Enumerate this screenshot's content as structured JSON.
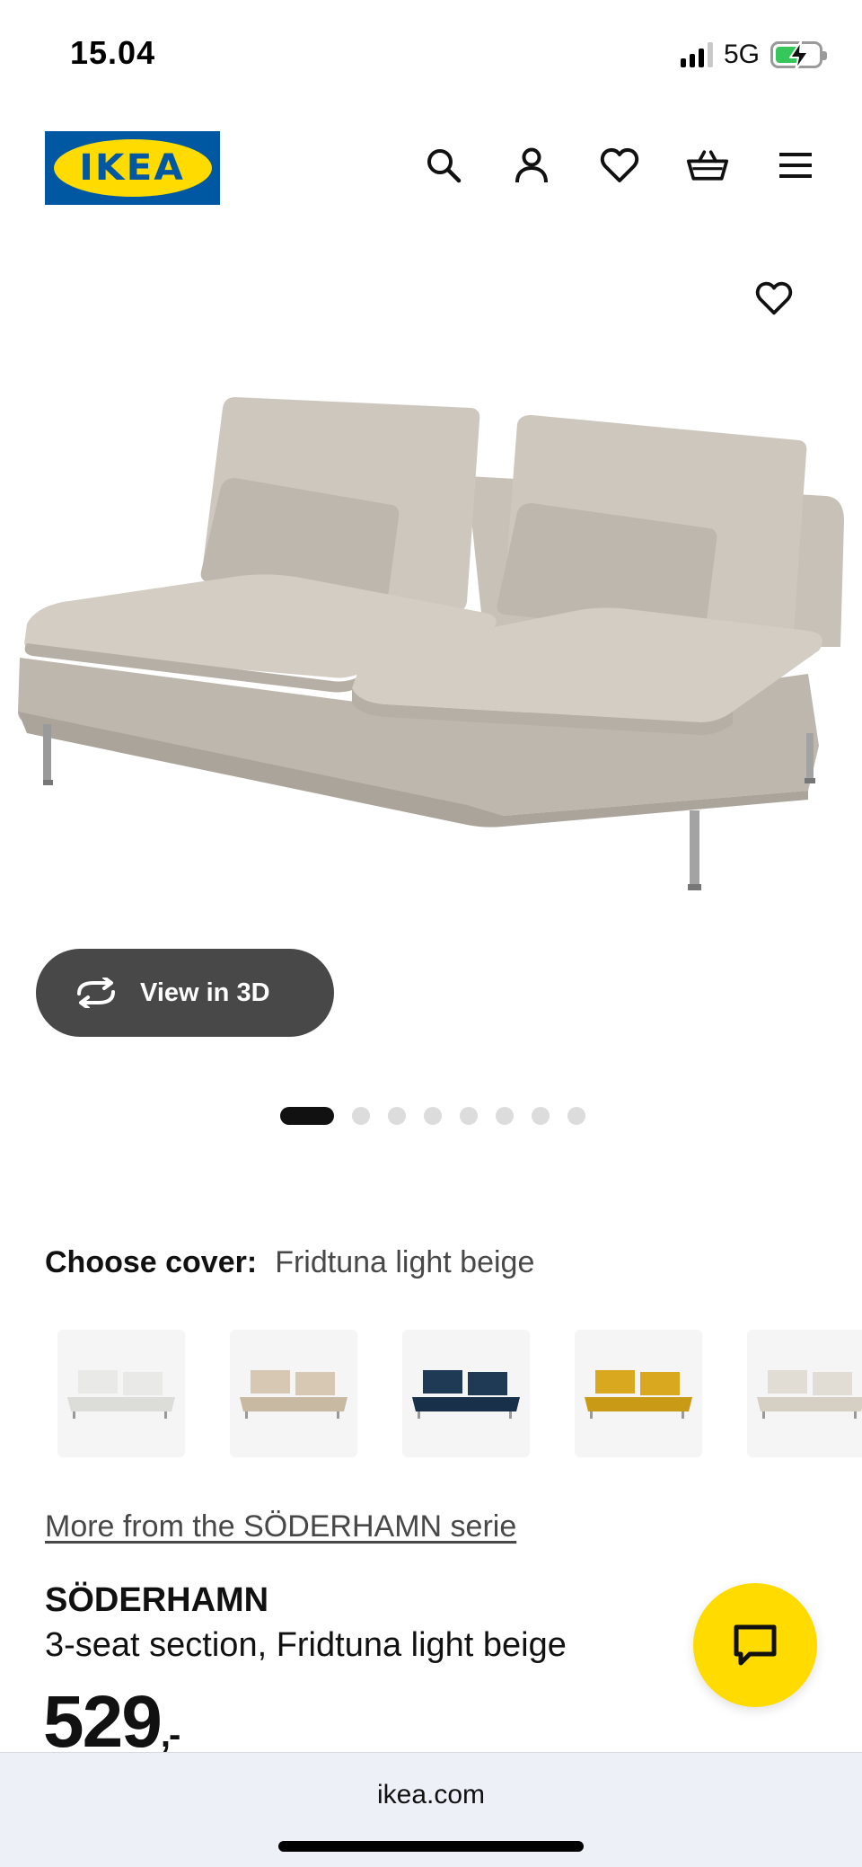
{
  "status_bar": {
    "time": "15.04",
    "network": "5G",
    "battery_color": "#35c759"
  },
  "header": {
    "logo_text": "IKEA",
    "icons": [
      "search-icon",
      "account-icon",
      "heart-icon",
      "basket-icon",
      "menu-icon"
    ]
  },
  "gallery": {
    "view_3d_label": "View in 3D",
    "slide_count": 8,
    "active_slide": 1
  },
  "cover": {
    "label": "Choose cover:",
    "value": "Fridtuna light beige",
    "swatch_colors": [
      "#e9e9e7",
      "#d6c8b2",
      "#1f3a55",
      "#d9a81e",
      "#e2ddd4"
    ]
  },
  "series_link": "More from the SÖDERHAMN serie",
  "product": {
    "name": "SÖDERHAMN",
    "description": "3-seat section, Fridtuna light beige",
    "price": "529",
    "price_suffix": ",-"
  },
  "browser": {
    "url": "ikea.com"
  },
  "colors": {
    "brand_blue": "#0058a3",
    "brand_yellow": "#ffdb00"
  }
}
